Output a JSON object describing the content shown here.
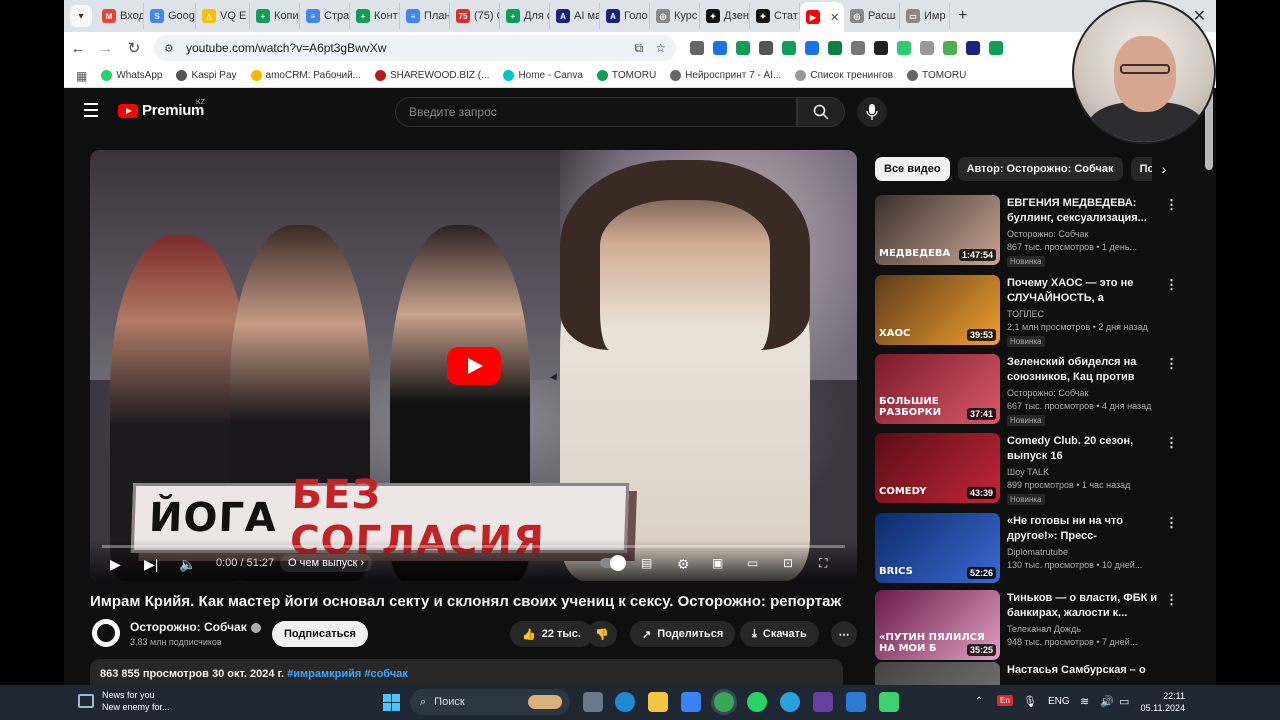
{
  "browser": {
    "tabs": [
      {
        "label": "",
        "color": "#dee3ea"
      },
      {
        "label": "Входя",
        "color": "#ea4335",
        "glyph": "M"
      },
      {
        "label": "Goog",
        "color": "#4285f4",
        "glyph": "S"
      },
      {
        "label": "VQ E",
        "color": "#fbbc04",
        "glyph": "△"
      },
      {
        "label": "Копи",
        "color": "#0f9d58",
        "glyph": "+"
      },
      {
        "label": "Стра",
        "color": "#4285f4",
        "glyph": "≡"
      },
      {
        "label": "Конт",
        "color": "#0f9d58",
        "glyph": "+"
      },
      {
        "label": "План",
        "color": "#4285f4",
        "glyph": "≡"
      },
      {
        "label": "(75) С",
        "color": "#d93025",
        "glyph": "75"
      },
      {
        "label": "Для с",
        "color": "#0f9d58",
        "glyph": "+"
      },
      {
        "label": "AI ма",
        "color": "#1a237e",
        "glyph": "A"
      },
      {
        "label": "Голо",
        "color": "#1a237e",
        "glyph": "A"
      },
      {
        "label": "Курс",
        "color": "#888888",
        "glyph": "◎"
      },
      {
        "label": "Дзен",
        "color": "#111111",
        "glyph": "✦"
      },
      {
        "label": "Стат",
        "color": "#111111",
        "glyph": "✦"
      },
      {
        "label": "",
        "color": "#ff0000",
        "glyph": "▶"
      },
      {
        "label": "Расш",
        "color": "#888888",
        "glyph": "◎"
      },
      {
        "label": "Имр",
        "color": "#888888",
        "glyph": "▭"
      }
    ],
    "url": "youtube.com/watch?v=A6pt3gBwvXw",
    "bookmarks": [
      {
        "label": "WhatsApp",
        "color": "#25d366"
      },
      {
        "label": "Kaspi Pay",
        "color": "#555555"
      },
      {
        "label": "amoCRM: Рабочий...",
        "color": "#ffb300"
      },
      {
        "label": "SHAREWOOD.BIZ (...",
        "color": "#b71c1c"
      },
      {
        "label": "Home - Canva",
        "color": "#00c4cc"
      },
      {
        "label": "TOMORU",
        "color": "#0f9d58"
      },
      {
        "label": "Нейроспринт 7 - AI...",
        "color": "#666666"
      },
      {
        "label": "Список тренингов",
        "color": "#999999"
      },
      {
        "label": "TOMORU",
        "color": "#666666"
      }
    ]
  },
  "youtube": {
    "logo_text": "Premium",
    "region": "KZ",
    "search_placeholder": "Введите запрос",
    "player": {
      "thumb_word1": "ЙОГА",
      "thumb_word2": "БЕЗ СОГЛАСИЯ",
      "time": "0:00 / 51:27",
      "chapter": "О чем выпуск"
    },
    "video": {
      "title": "Имрам Крийя. Как мастер йоги основал секту и склонял своих учениц к сексу. Осторожно: репортаж",
      "channel": "Осторожно: Собчак",
      "subscribers": "3,83 млн подписчиков",
      "subscribe_label": "Подписаться",
      "likes": "22 тыс.",
      "share_label": "Поделиться",
      "download_label": "Скачать",
      "views_date": "863 855 просмотров  30 окт. 2024 г.",
      "hashtags": "#имрамкрийя #собчак"
    },
    "chips": [
      "Все видео",
      "Автор: Осторожно: Собчак",
      "Похо"
    ],
    "recommendations": [
      {
        "title": "ЕВГЕНИЯ МЕДВЕДЕВА: буллинг, сексуализация...",
        "channel": "Осторожно: Собчак",
        "meta": "867 тыс. просмотров • 1 день...",
        "duration": "1:47:54",
        "badge": "Новинка",
        "thumb_text": "МЕДВЕДЕВА",
        "c1": "#3a2f2c",
        "c2": "#c9a693"
      },
      {
        "title": "Почему ХАОС — это не СЛУЧАЙНОСТЬ, а ПОРЯДОК...",
        "channel": "ТОПЛЕС",
        "meta": "2,1 млн просмотров • 2 дня назад",
        "duration": "39:53",
        "badge": "Новинка",
        "thumb_text": "ХАОС",
        "c1": "#5d3a1a",
        "c2": "#f0a030"
      },
      {
        "title": "Зеленский обиделся на союзников, Кац против ФБК,...",
        "channel": "Осторожно: Собчак",
        "meta": "667 тыс. просмотров • 4 дня назад",
        "duration": "37:41",
        "badge": "Новинка",
        "thumb_text": "БОЛЬШИЕ РАЗБОРКИ",
        "c1": "#7a1a2a",
        "c2": "#d85a6a"
      },
      {
        "title": "Comedy Club. 20 сезон, выпуск 16",
        "channel": "Шоу TALK",
        "meta": "899 просмотров • 1 час назад",
        "duration": "43:39",
        "badge": "Новинка",
        "thumb_text": "COMEDY",
        "c1": "#5a0d14",
        "c2": "#c2263a"
      },
      {
        "title": "«Не готовы ни на что другое!»: Пресс-конференция...",
        "channel": "Diplomatrutube",
        "meta": "130 тыс. просмотров • 10 дней...",
        "duration": "52:26",
        "badge": "",
        "thumb_text": "BRICS",
        "c1": "#0d2a6a",
        "c2": "#3a6ad0"
      },
      {
        "title": "Тиньков — о власти, ФБК и банкирах, жалости к...",
        "channel": "Телеканал Дождь",
        "meta": "948 тыс. просмотров • 7 дней...",
        "duration": "35:25",
        "badge": "",
        "thumb_text": "«ПУТИН ПЯЛИЛСЯ НА МОИ Б",
        "c1": "#6a1a4a",
        "c2": "#e0a0c0"
      },
      {
        "title": "Настасья Самбурская – о",
        "channel": "",
        "meta": "",
        "duration": "",
        "badge": "",
        "thumb_text": "",
        "c1": "#444444",
        "c2": "#777777"
      }
    ]
  },
  "taskbar": {
    "news_title": "News for you",
    "news_sub": "New enemy for...",
    "search": "Поиск",
    "lang": "ENG",
    "lang_badge": "En",
    "time": "22:11",
    "date": "05.11.2024"
  }
}
